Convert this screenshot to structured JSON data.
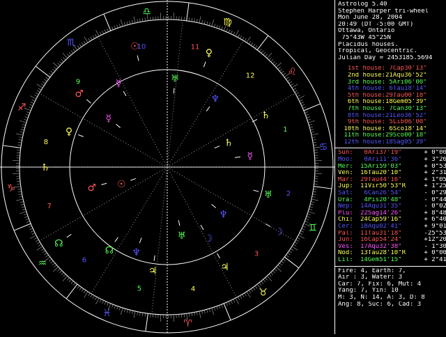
{
  "header": {
    "program": "Astrolog 5.40",
    "chart_name": "Stephen Harper tri-wheel",
    "date": "Mon June 28, 2004",
    "time": "20:49 (DT -5:00 GMT)",
    "place": "Ottawa, Ontario",
    "coords": " 75°43W 45°25N",
    "house_system": "Placidus houses.",
    "zodiac": "Tropical, Geocentric.",
    "julian": "Julian Day = 2453185.5694"
  },
  "houses": [
    {
      "label": "1st house:",
      "value": " 7Cap30'13\"",
      "color": "#ff5555"
    },
    {
      "label": "2nd house:",
      "value": "21Aqu36'52\"",
      "color": "#ffff55"
    },
    {
      "label": "3rd house:",
      "value": " 5Ari06'00\"",
      "color": "#55ff55"
    },
    {
      "label": "4th house:",
      "value": " 6Tau18'14\"",
      "color": "#5555ff"
    },
    {
      "label": "5th house:",
      "value": "29Tau00'18\"",
      "color": "#ff5555"
    },
    {
      "label": "6th house:",
      "value": "18Gem05'39\"",
      "color": "#ffff55"
    },
    {
      "label": "7th house:",
      "value": " 7Can30'13\"",
      "color": "#55ff55"
    },
    {
      "label": "8th house:",
      "value": "21Leo36'52\"",
      "color": "#5555ff"
    },
    {
      "label": "9th house:",
      "value": " 5Lib06'00\"",
      "color": "#ff5555"
    },
    {
      "label": "10th house:",
      "value": " 6Sco18'14\"",
      "color": "#ffff55"
    },
    {
      "label": "11th house:",
      "value": "29Sco00'18\"",
      "color": "#55ff55"
    },
    {
      "label": "12th house:",
      "value": "18Sag05'39\"",
      "color": "#5555ff"
    }
  ],
  "planets": [
    {
      "name": "Sun:",
      "pos": " 0Ari37'19\"",
      "lat": " + 0°00'",
      "color": "#ff5555"
    },
    {
      "name": "Moo:",
      "pos": " 0Ari11'36\"",
      "lat": " + 3°26'",
      "color": "#5555ff"
    },
    {
      "name": "Mer:",
      "pos": "15Ari59'03\"",
      "lat": " + 0°53'",
      "color": "#55ff55"
    },
    {
      "name": "Ven:",
      "pos": "16Tau20'10\"",
      "lat": " + 2°31'",
      "color": "#ffff55"
    },
    {
      "name": "Mar:",
      "pos": "29Tau44'16\"",
      "lat": " + 1°05'",
      "color": "#ff5555"
    },
    {
      "name": "Jup:",
      "pos": "11Vir50'53\"R",
      "lat": " + 1°25'",
      "color": "#ffff55"
    },
    {
      "name": "Sat:",
      "pos": " 6Can26'54\"",
      "lat": " - 0°29'",
      "color": "#5555ff"
    },
    {
      "name": "Ura:",
      "pos": " 4Pis20'48\"",
      "lat": " - 0°44'",
      "color": "#55ff55"
    },
    {
      "name": "Nep:",
      "pos": "14Aqu31'35\"",
      "lat": " - 0°02'",
      "color": "#5555ff"
    },
    {
      "name": "Plu:",
      "pos": "22Sag14'26\"",
      "lat": " + 8°48'",
      "color": "#ff55ff"
    },
    {
      "name": "Chi:",
      "pos": "24Cap59'16\"",
      "lat": " + 6°40'",
      "color": "#ffff55"
    },
    {
      "name": "Cer:",
      "pos": "18Aqu02'41\"",
      "lat": " + 9°01'",
      "color": "#5555ff"
    },
    {
      "name": "Pal:",
      "pos": "11Tau31'18\"",
      "lat": " -25°53'",
      "color": "#ff5555"
    },
    {
      "name": "Jun:",
      "pos": "16Cap54'24\"",
      "lat": " +12°20'",
      "color": "#ff5555"
    },
    {
      "name": "Ves:",
      "pos": "17Aqu32'38\"",
      "lat": " - 1°30'",
      "color": "#ff55ff"
    },
    {
      "name": "Nod:",
      "pos": "13Tau28'10\"R",
      "lat": " + 0°00'",
      "color": "#ffff55"
    },
    {
      "name": "Lil:",
      "pos": "14Gem51'15\"",
      "lat": " + 2°41'",
      "color": "#55ff55"
    }
  ],
  "summary": [
    "Fire: 4, Earth: 7,",
    "Air : 3, Water: 3",
    "Car: 7, Fix: 6, Mut: 4",
    "Yang: 7, Yin: 10",
    "M: 3, N: 14, A: 3, D: 8",
    "Ang: 8, Suc: 6, Cad: 3"
  ],
  "wheel": {
    "house_numbers": [
      "1",
      "2",
      "3",
      "4",
      "5",
      "6",
      "7",
      "8",
      "9",
      "10",
      "11",
      "12"
    ],
    "signs": [
      {
        "glyph": "♑",
        "color": "#ff5555"
      },
      {
        "glyph": "♒",
        "color": "#55ff55"
      },
      {
        "glyph": "♓",
        "color": "#5555ff"
      },
      {
        "glyph": "♈",
        "color": "#ff5555"
      },
      {
        "glyph": "♉",
        "color": "#ffff55"
      },
      {
        "glyph": "♊",
        "color": "#55ff55"
      },
      {
        "glyph": "♋",
        "color": "#5555ff"
      },
      {
        "glyph": "♌",
        "color": "#ff5555"
      },
      {
        "glyph": "♍",
        "color": "#ffff55"
      },
      {
        "glyph": "♎",
        "color": "#55ff55"
      },
      {
        "glyph": "♏",
        "color": "#5555ff"
      },
      {
        "glyph": "♐",
        "color": "#ff5555"
      }
    ],
    "planet_glyphs": [
      {
        "glyph": "♆",
        "color": "#5555ff"
      },
      {
        "glyph": "♅",
        "color": "#55ff55"
      },
      {
        "glyph": "☿",
        "color": "#ff55ff"
      },
      {
        "glyph": "♄",
        "color": "#ffff55"
      },
      {
        "glyph": "♀",
        "color": "#ffff55"
      },
      {
        "glyph": "♂",
        "color": "#ff5555"
      },
      {
        "glyph": "☉",
        "color": "#ff5555"
      },
      {
        "glyph": "☊",
        "color": "#55ff55"
      },
      {
        "glyph": "♃",
        "color": "#ffff55"
      },
      {
        "glyph": "☽",
        "color": "#5555ff"
      }
    ]
  }
}
